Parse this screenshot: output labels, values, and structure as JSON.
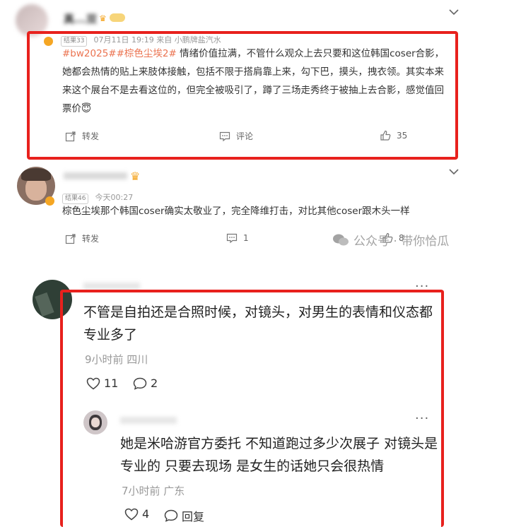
{
  "post1": {
    "username": "真...双",
    "level_badge": "结果33",
    "meta": "07月11日 19:19  来自 小鹏牌盐汽水",
    "tags": "#bw2025##棕色尘埃2#",
    "text": " 情绪价值拉满，不管什么观众上去只要和这位韩国coser合影，她都会热情的贴上来肢体接触，包括不限于搭肩靠上来，勾下巴，摸头，拽衣领。其实本来来这个展台不是去看这位的，但完全被吸引了，蹲了三场走秀终于被抽上去合影，感觉值回票价",
    "emoji": "😇",
    "actions": {
      "repost": "转发",
      "comment": "评论",
      "like_count": "35"
    }
  },
  "post2": {
    "level_badge": "结果46",
    "meta": "今天00:27",
    "text": "棕色尘埃那个韩国coser确实太敬业了，完全降维打击，对比其他coser跟木头一样",
    "actions": {
      "repost": "转发",
      "comment_count": "1",
      "like_count": "8"
    },
    "watermark": "公众号 · 带你恰瓜"
  },
  "comment1": {
    "text": "不管是自拍还是合照时候，对镜头，对男生的表情和仪态都专业多了",
    "meta": "9小时前 四川",
    "like_count": "11",
    "reply_count": "2",
    "more": "..."
  },
  "reply1": {
    "text": "她是米哈游官方委托 不知道跑过多少次展子 对镜头是专业的 只要去现场 是女生的话她只会很热情",
    "meta": "7小时前 广东",
    "like_count": "4",
    "reply_label": "回复",
    "more": "..."
  }
}
